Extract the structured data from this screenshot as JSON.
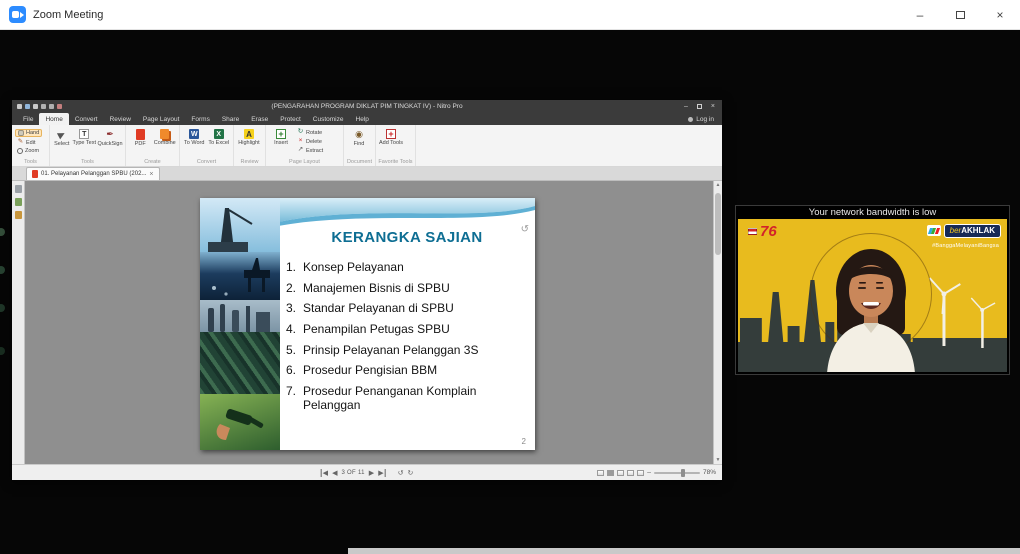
{
  "colors": {
    "zoom_blue": "#2D8CFF",
    "cam_yellow": "#E8BB1E",
    "logo_red": "#D2232A",
    "berakhlak_navy": "#172A56",
    "slide_title_teal": "#0E6E93",
    "pdf_red": "#E03B24",
    "word_blue": "#2B579A",
    "excel_green": "#217346"
  },
  "zoom_window": {
    "title": "Zoom Meeting"
  },
  "icons": {
    "minimize": "–",
    "close": "×",
    "edit_pencil": "✎",
    "quicksign_pen": "✒",
    "select_cursor": "▶",
    "type_text": "T",
    "to_word": "W",
    "to_excel": "X",
    "highlight": "A",
    "insert_plus": "+",
    "rotate_cw": "↻",
    "rotate_ccw": "↺",
    "delete_x": "×",
    "extract_arrow": "↗",
    "find_target": "◉",
    "add_plus": "+",
    "nav_prev": "◀",
    "nav_next": "▶",
    "scroll_up": "▲",
    "scroll_down": "▼"
  },
  "nitro": {
    "title": "(PENGARAHAN PROGRAM DIKLAT PIM TINGKAT IV) - Nitro Pro",
    "login_label": "Log in",
    "tabs": [
      "File",
      "Home",
      "Convert",
      "Review",
      "Page Layout",
      "Forms",
      "Share",
      "Erase",
      "Protect",
      "Customize",
      "Help"
    ],
    "ribbon": {
      "buttons": {
        "hand": "Hand",
        "edit": "Edit",
        "zoom": "Zoom",
        "select": "Select",
        "type_text": "Type Text",
        "quicksign": "QuickSign",
        "pdf": "PDF",
        "combine": "Combine",
        "to_word": "To Word",
        "to_excel": "To Excel",
        "highlight": "Highlight",
        "insert": "Insert",
        "rotate": "Rotate",
        "delete": "Delete",
        "extract": "Extract",
        "find": "Find",
        "add_tools": "Add Tools"
      },
      "groups": [
        "Tools",
        "Tools",
        "Create",
        "Convert",
        "Review",
        "Page Layout",
        "Document",
        "Favorite Tools"
      ]
    },
    "doc_tab_label": "01. Pelayanan Pelanggan SPBU (202...",
    "statusbar": {
      "page_label": "3 OF 11",
      "zoom_level": "78%"
    }
  },
  "slide": {
    "title": "KERANGKA SAJIAN",
    "items": [
      {
        "n": "1.",
        "t": "Konsep Pelayanan"
      },
      {
        "n": "2.",
        "t": "Manajemen Bisnis di SPBU"
      },
      {
        "n": "3.",
        "t": "Standar Pelayanan di SPBU"
      },
      {
        "n": "4.",
        "t": "Penampilan Petugas SPBU"
      },
      {
        "n": "5.",
        "t": "Prinsip Pelayanan Pelanggan 3S"
      },
      {
        "n": "6.",
        "t": "Prosedur Pengisian BBM"
      },
      {
        "n": "7.",
        "t": "Prosedur Penanganan Komplain Pelanggan"
      }
    ],
    "page_number": "2"
  },
  "webcam": {
    "banner": "Your network bandwidth is low",
    "logo_76": "76",
    "berakhlak_prefix": "ber",
    "berakhlak_main": "AKHLAK",
    "hashtag": "#BanggaMelayaniBangsa"
  }
}
